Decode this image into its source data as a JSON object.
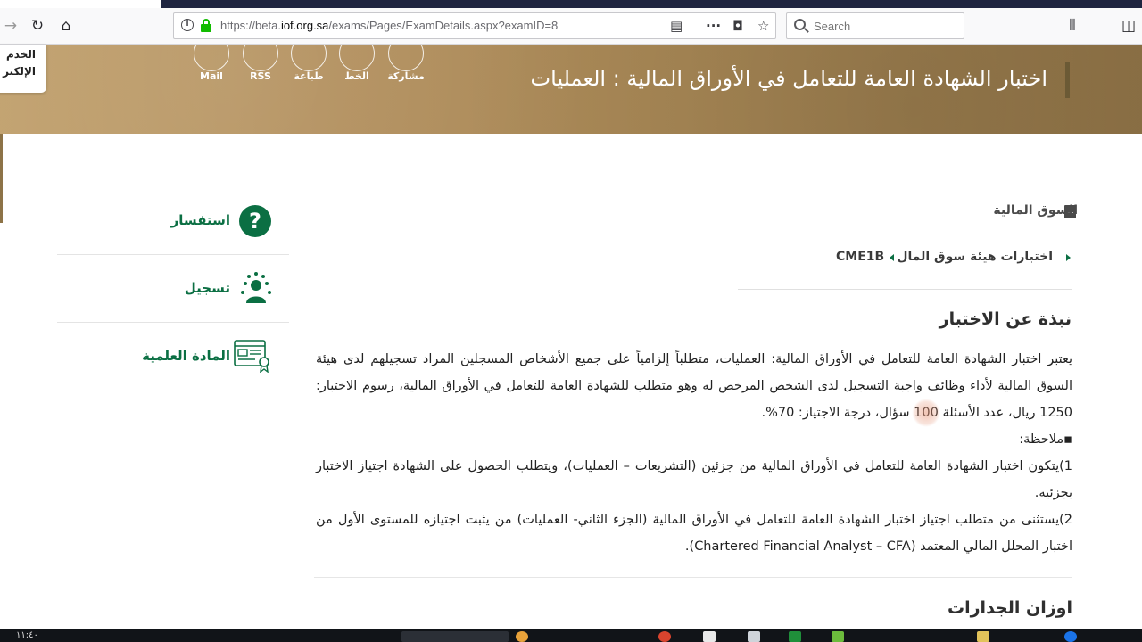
{
  "browser": {
    "url_prefix": "https://beta.",
    "url_domain": "iof.org.sa",
    "url_path": "/exams/Pages/ExamDetails.aspx?examID=8",
    "search_placeholder": "Search"
  },
  "banner": {
    "title": "اختبار الشهادة العامة للتعامل في الأوراق المالية : العمليات",
    "share_items": [
      "مشاركة",
      "الخط",
      "طباعة",
      "RSS",
      "Mail"
    ],
    "eservice_line1": "الخدم",
    "eservice_line2": "الإلكتر"
  },
  "breadcrumb": {
    "level1": "السوق المالية",
    "level2": "اختبارات هيئة سوق المال",
    "code": "CME1B"
  },
  "about": {
    "heading": "نبذة عن الاختبار",
    "p1": "يعتبر اختبار الشهادة العامة للتعامل في الأوراق المالية: العمليات، متطلباً إلزامياً على جميع الأشخاص المسجلين المراد تسجيلهم لدى هيئة السوق المالية لأداء وظائف واجبة التسجيل لدى الشخص المرخص له وهو متطلب للشهادة العامة للتعامل في الأوراق المالية، رسوم الاختبار: 1250 ريال، عدد الأسئلة 100 سؤال، درجة الاجتياز: 70%.",
    "note_label": "▪ملاحظة:",
    "note1": "1)يتكون اختبار الشهادة العامة للتعامل في الأوراق المالية من جزئين (التشريعات – العمليات)، ويتطلب الحصول على الشهادة اجتياز الاختبار بجزئيه.",
    "note2": "2)يستثنى من متطلب اجتياز اختبار الشهادة العامة للتعامل في الأوراق المالية (الجزء الثاني- العمليات) من يثبت اجتيازه للمستوى الأول من اختبار المحلل المالي المعتمد (Chartered Financial Analyst – CFA)."
  },
  "weights": {
    "heading": "اوزان الجدارات"
  },
  "side_panel": {
    "inquiry": "استفسار",
    "register": "تسجيل",
    "material": "المادة العلمية"
  },
  "taskbar": {
    "clock": "١١:٤٠"
  },
  "colors": {
    "accent_green": "#0b6f43",
    "banner_gold": "#b28f5d"
  }
}
